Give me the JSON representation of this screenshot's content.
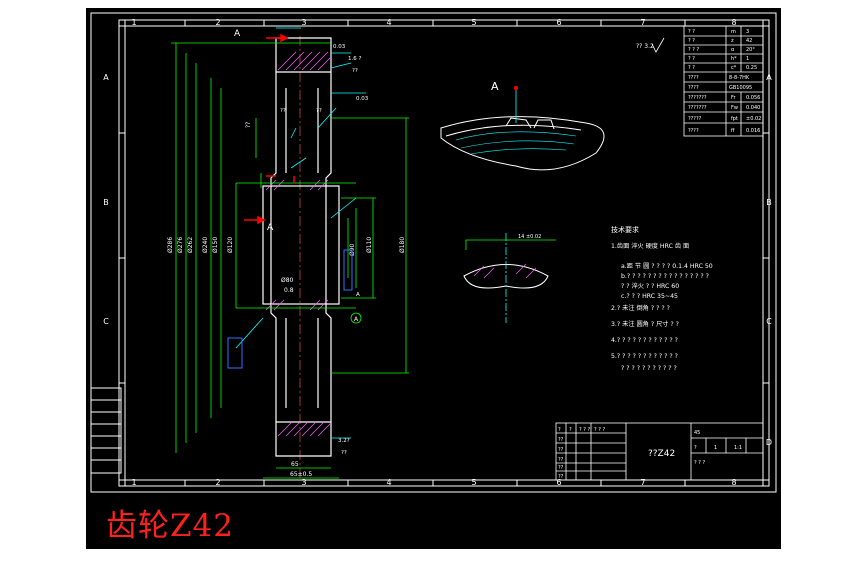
{
  "title_caption": "齿轮Z42",
  "frame": {
    "col_labels": [
      "1",
      "2",
      "3",
      "4",
      "5",
      "6",
      "7",
      "8"
    ],
    "row_labels": [
      "A",
      "B",
      "C",
      "D"
    ]
  },
  "drawing": {
    "section_label_top": "A",
    "section_label_side": "A",
    "detail_view_label": "A",
    "circle_marker": "A",
    "roughness_note": "?? 3.2",
    "tech_requirements": {
      "heading": "技术要求",
      "lines": [
        "1.齿面 淬火 硬度 HRC 齿 面",
        "a.距 节 圆 ? ? ? ? 0.1.4 HRC 50",
        "b.? ? ? ? ? ? ? ? ? ? ? ? ? ? ? ?",
        "? ? 淬火 ? ? HRC 60",
        "c.? ? ? HRC 35~45",
        "2.? 未注 倒角 ? ? ? ?",
        "3.? 未注 圆角 ? 尺寸 ? ?",
        "4.? ? ? ? ? ? ? ? ? ? ? ?",
        "5.? ? ? ? ? ? ? ? ? ? ? ?",
        "? ? ? ? ? ? ? ? ? ? ?"
      ]
    },
    "title_block": {
      "part_name": "??Z42"
    }
  },
  "colors": {
    "background": "#000000",
    "frame": "#ffffff",
    "dimension": "#00ff00",
    "leader": "#00ffff",
    "hatch": "#ff60ff",
    "section_arrow": "#ff0000",
    "centerline": "#00ffff",
    "caption": "#ff2020"
  }
}
